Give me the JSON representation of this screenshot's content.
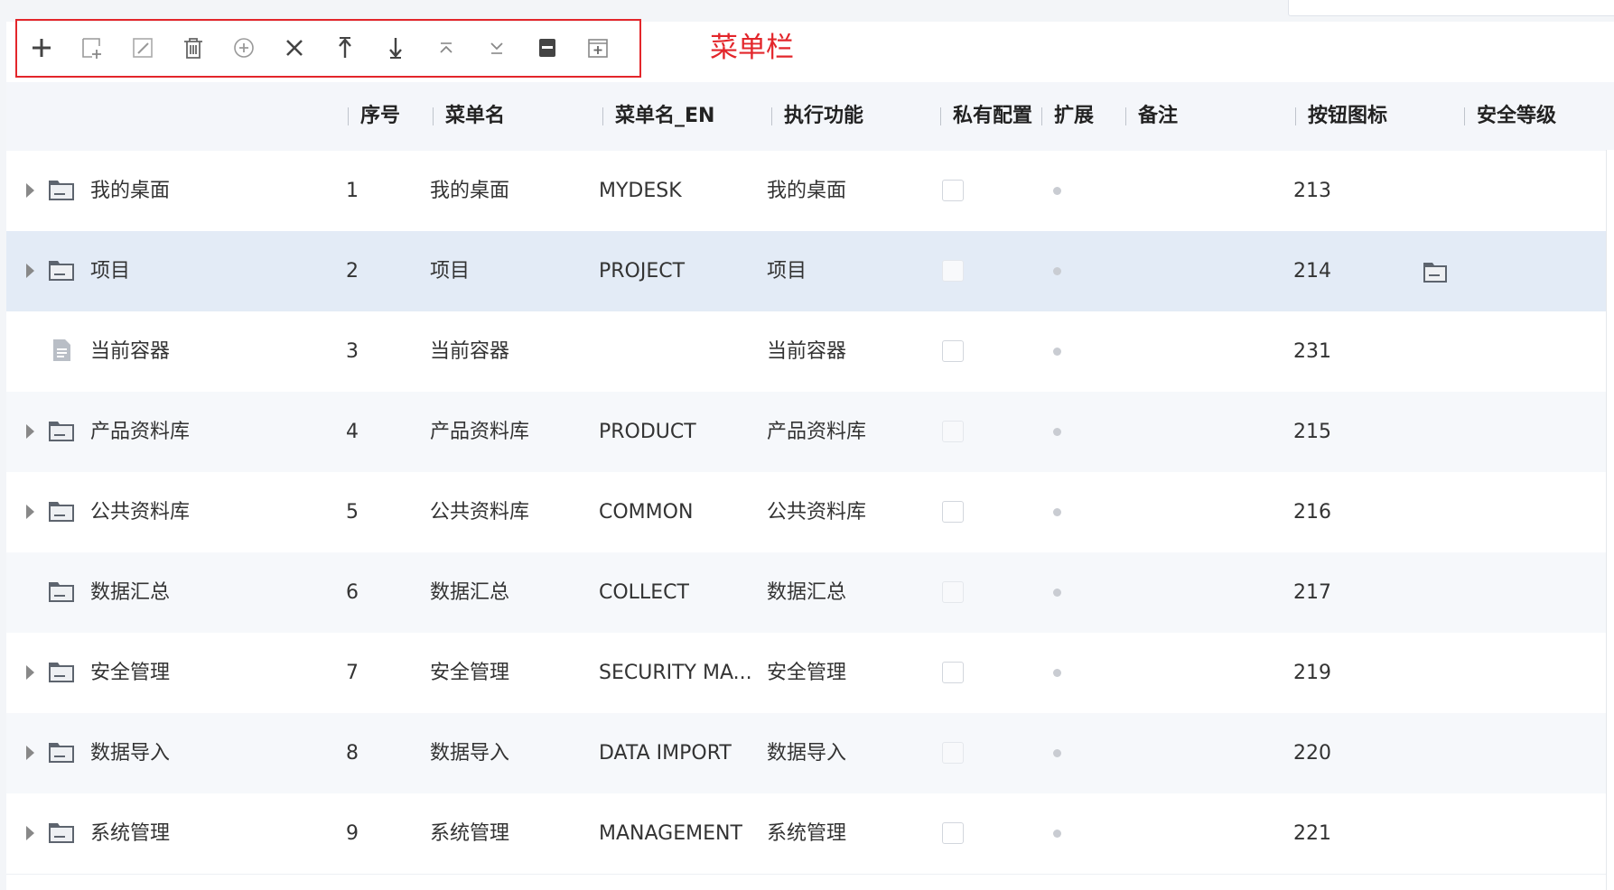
{
  "toolbar": {
    "buttons": [
      {
        "name": "add-icon",
        "label": "+"
      },
      {
        "name": "add-child-icon",
        "label": ""
      },
      {
        "name": "edit-icon",
        "label": ""
      },
      {
        "name": "delete-icon",
        "label": ""
      },
      {
        "name": "add-circle-icon",
        "label": ""
      },
      {
        "name": "close-icon",
        "label": ""
      },
      {
        "name": "move-up-icon",
        "label": ""
      },
      {
        "name": "move-down-icon",
        "label": ""
      },
      {
        "name": "collapse-all-icon",
        "label": ""
      },
      {
        "name": "expand-all-icon",
        "label": ""
      },
      {
        "name": "save-icon",
        "label": ""
      },
      {
        "name": "add-box-icon",
        "label": ""
      }
    ],
    "annotation": "菜单栏",
    "highlight_color": "#e3262b"
  },
  "table": {
    "columns": {
      "seq": "序号",
      "name": "菜单名",
      "name_en": "菜单名_EN",
      "func": "执行功能",
      "private": "私有配置",
      "ext": "扩展",
      "remark": "备注",
      "btn_icon": "按钮图标",
      "security": "安全等级"
    },
    "rows": [
      {
        "tree": "我的桌面",
        "seq": "1",
        "name": "我的桌面",
        "name_en": "MYDESK",
        "func": "我的桌面",
        "btn_icon": "213",
        "expandable": true,
        "node": "folder"
      },
      {
        "tree": "项目",
        "seq": "2",
        "name": "项目",
        "name_en": "PROJECT",
        "func": "项目",
        "btn_icon": "214",
        "expandable": true,
        "node": "folder",
        "selected": true,
        "security_icon": "folder-icon"
      },
      {
        "tree": "当前容器",
        "seq": "3",
        "name": "当前容器",
        "name_en": "",
        "func": "当前容器",
        "btn_icon": "231",
        "expandable": false,
        "node": "document"
      },
      {
        "tree": "产品资料库",
        "seq": "4",
        "name": "产品资料库",
        "name_en": "PRODUCT",
        "func": "产品资料库",
        "btn_icon": "215",
        "expandable": true,
        "node": "folder"
      },
      {
        "tree": "公共资料库",
        "seq": "5",
        "name": "公共资料库",
        "name_en": "COMMON",
        "func": "公共资料库",
        "btn_icon": "216",
        "expandable": true,
        "node": "folder"
      },
      {
        "tree": "数据汇总",
        "seq": "6",
        "name": "数据汇总",
        "name_en": "COLLECT",
        "func": "数据汇总",
        "btn_icon": "217",
        "expandable": false,
        "node": "folder"
      },
      {
        "tree": "安全管理",
        "seq": "7",
        "name": "安全管理",
        "name_en": "SECURITY MA...",
        "func": "安全管理",
        "btn_icon": "219",
        "expandable": true,
        "node": "folder"
      },
      {
        "tree": "数据导入",
        "seq": "8",
        "name": "数据导入",
        "name_en": "DATA IMPORT",
        "func": "数据导入",
        "btn_icon": "220",
        "expandable": true,
        "node": "folder"
      },
      {
        "tree": "系统管理",
        "seq": "9",
        "name": "系统管理",
        "name_en": "MANAGEMENT",
        "func": "系统管理",
        "btn_icon": "221",
        "expandable": true,
        "node": "folder"
      }
    ]
  }
}
